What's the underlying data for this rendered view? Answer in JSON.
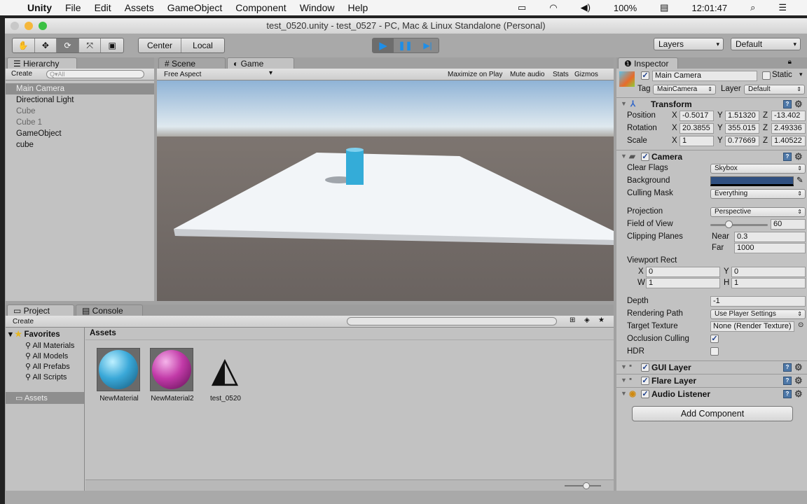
{
  "menubar": {
    "app": "Unity",
    "items": [
      "File",
      "Edit",
      "Assets",
      "GameObject",
      "Component",
      "Window",
      "Help"
    ],
    "battery": "100%",
    "clock": "12:01:47"
  },
  "window": {
    "title": "test_0520.unity - test_0527 - PC, Mac & Linux Standalone (Personal)"
  },
  "toolbar": {
    "center": "Center",
    "local": "Local",
    "layers": "Layers",
    "layout": "Default"
  },
  "hierarchy": {
    "tab": "Hierarchy",
    "create": "Create",
    "search_placeholder": "Q▾All",
    "items": [
      "Main Camera",
      "Directional Light",
      "Cube",
      "Cube 1",
      "GameObject",
      "cube"
    ]
  },
  "game": {
    "tabs": [
      "Scene",
      "Game"
    ],
    "aspect": "Free Aspect",
    "buttons": [
      "Maximize on Play",
      "Mute audio",
      "Stats",
      "Gizmos"
    ]
  },
  "project": {
    "tabs": [
      "Project",
      "Console"
    ],
    "create": "Create",
    "favorites": "Favorites",
    "fav_items": [
      "All Materials",
      "All Models",
      "All Prefabs",
      "All Scripts"
    ],
    "assets_folder": "Assets",
    "breadcrumb": "Assets",
    "assets": [
      {
        "name": "NewMaterial",
        "color": "#3aa8d8"
      },
      {
        "name": "NewMaterial2",
        "color": "#c23aa8"
      },
      {
        "name": "test_0520"
      }
    ]
  },
  "inspector": {
    "tab": "Inspector",
    "name": "Main Camera",
    "static": "Static",
    "tag_label": "Tag",
    "tag": "MainCamera",
    "layer_label": "Layer",
    "layer": "Default",
    "transform": {
      "title": "Transform",
      "rows": [
        {
          "label": "Position",
          "x": "-0.5017",
          "y": "1.51320",
          "z": "-13.402"
        },
        {
          "label": "Rotation",
          "x": "20.3855",
          "y": "355.015",
          "z": "2.49336"
        },
        {
          "label": "Scale",
          "x": "1",
          "y": "0.77669",
          "z": "1.40522"
        }
      ]
    },
    "camera": {
      "title": "Camera",
      "clear_flags_label": "Clear Flags",
      "clear_flags": "Skybox",
      "background_label": "Background",
      "background_color": "#2f4f80",
      "culling_label": "Culling Mask",
      "culling": "Everything",
      "projection_label": "Projection",
      "projection": "Perspective",
      "fov_label": "Field of View",
      "fov": "60",
      "fov_fraction": 0.32,
      "clip_label": "Clipping Planes",
      "near_label": "Near",
      "near": "0.3",
      "far_label": "Far",
      "far": "1000",
      "viewport_label": "Viewport Rect",
      "vx": "0",
      "vy": "0",
      "vw": "1",
      "vh": "1",
      "depth_label": "Depth",
      "depth": "-1",
      "render_label": "Rendering Path",
      "render": "Use Player Settings",
      "target_label": "Target Texture",
      "target": "None (Render Texture)",
      "occlusion_label": "Occlusion Culling",
      "hdr_label": "HDR"
    },
    "components": [
      "GUI Layer",
      "Flare Layer",
      "Audio Listener"
    ],
    "add_component": "Add Component"
  }
}
